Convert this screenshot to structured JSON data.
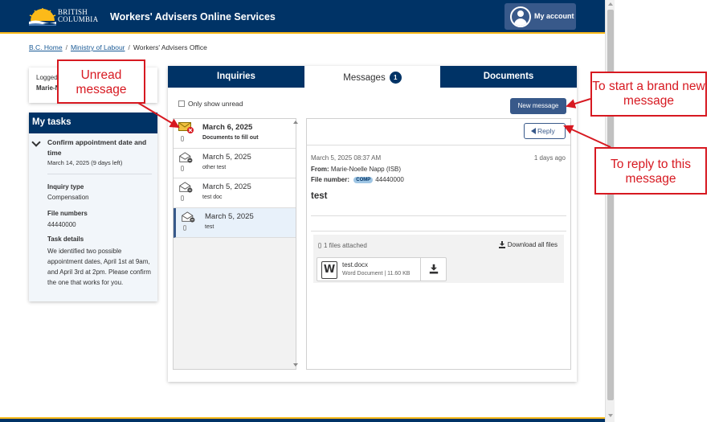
{
  "header": {
    "logo_line1": "BRITISH",
    "logo_line2": "COLUMBIA",
    "title": "Workers' Advisers Online Services",
    "account_label": "My account"
  },
  "breadcrumb": {
    "home": "B.C. Home",
    "ministry": "Ministry of Labour",
    "office": "Workers' Advisers Office"
  },
  "logged_card": {
    "line1": "Logged",
    "line2": "Marie-N"
  },
  "tasks": {
    "heading": "My tasks",
    "task_title": "Confirm appointment date and time",
    "task_date": "March 14, 2025 (9 days left)",
    "inquiry_type_label": "Inquiry type",
    "inquiry_type_value": "Compensation",
    "file_numbers_label": "File numbers",
    "file_numbers_value": "44440000",
    "details_label": "Task details",
    "details_text": "We identified two possible appointment dates, April 1st at 9am, and April 3rd at 2pm. Please confirm the one that works for you."
  },
  "tabs": {
    "inquiries": "Inquiries",
    "messages": "Messages",
    "messages_badge": "1",
    "documents": "Documents"
  },
  "toolbar": {
    "unread_filter_label": "Only show unread",
    "new_message_label": "New message"
  },
  "messages": [
    {
      "date": "March 6, 2025",
      "subject": "Documents to fill out",
      "unread": true
    },
    {
      "date": "March 5, 2025",
      "subject": "other test",
      "unread": false
    },
    {
      "date": "March 5, 2025",
      "subject": "test doc",
      "unread": false
    },
    {
      "date": "March 5, 2025",
      "subject": "test",
      "unread": false
    }
  ],
  "detail": {
    "reply_label": "Reply",
    "sent": "March 5, 2025 08:37 AM",
    "ago": "1 days ago",
    "from_label": "From:",
    "from_value": "Marie-Noelle Napp (ISB)",
    "file_number_label": "File number:",
    "file_tag": "COMP",
    "file_number_value": "44440000",
    "subject": "test",
    "attach_count": "1 files attached",
    "download_all": "Download all files",
    "file_name": "test.docx",
    "file_meta": "Word Document | 11.60 KB"
  },
  "annotations": {
    "unread": "Unread message",
    "new_message": "To start a brand new message",
    "reply": "To reply to this message"
  },
  "colors": {
    "primary": "#003366",
    "accent": "#fcba19",
    "button": "#38598a",
    "annotation": "#d71921"
  }
}
